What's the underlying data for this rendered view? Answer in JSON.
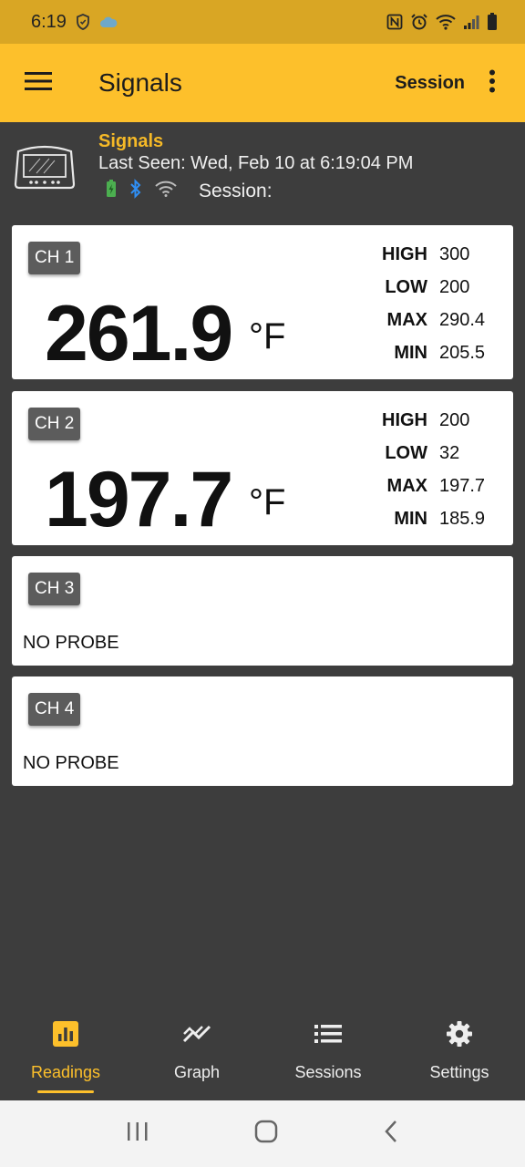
{
  "status_bar": {
    "time": "6:19",
    "icons": [
      "shield-icon",
      "cloud-icon",
      "nfc-icon",
      "alarm-icon",
      "wifi-icon",
      "signal-icon",
      "battery-icon"
    ]
  },
  "app_bar": {
    "title": "Signals",
    "session_label": "Session",
    "icons": [
      "menu-icon",
      "more-vert-icon"
    ]
  },
  "device": {
    "name": "Signals",
    "last_seen": "Last Seen: Wed, Feb 10 at 6:19:04 PM",
    "session_label": "Session:",
    "status_icons": [
      "battery-charging-icon",
      "bluetooth-icon",
      "wifi-icon"
    ],
    "colors": {
      "name": "#f5b927",
      "battery": "#4caf50",
      "bluetooth": "#2f8ff5"
    }
  },
  "channels": [
    {
      "label": "CH 1",
      "reading": "261.9",
      "unit": "°F",
      "stats": [
        {
          "label": "HIGH",
          "value": "300"
        },
        {
          "label": "LOW",
          "value": "200"
        },
        {
          "label": "MAX",
          "value": "290.4"
        },
        {
          "label": "MIN",
          "value": "205.5"
        }
      ]
    },
    {
      "label": "CH 2",
      "reading": "197.7",
      "unit": "°F",
      "stats": [
        {
          "label": "HIGH",
          "value": "200"
        },
        {
          "label": "LOW",
          "value": "32"
        },
        {
          "label": "MAX",
          "value": "197.7"
        },
        {
          "label": "MIN",
          "value": "185.9"
        }
      ]
    },
    {
      "label": "CH 3",
      "status": "NO PROBE"
    },
    {
      "label": "CH 4",
      "status": "NO PROBE"
    }
  ],
  "bottom_nav": {
    "items": [
      {
        "label": "Readings",
        "icon": "bar-chart-icon",
        "active": true
      },
      {
        "label": "Graph",
        "icon": "trending-icon",
        "active": false
      },
      {
        "label": "Sessions",
        "icon": "list-icon",
        "active": false
      },
      {
        "label": "Settings",
        "icon": "gear-icon",
        "active": false
      }
    ],
    "colors": {
      "active": "#fdc02b",
      "inactive": "#eeeeee"
    }
  },
  "system_nav": {
    "icons": [
      "recents-icon",
      "home-icon",
      "back-icon"
    ]
  },
  "theme": {
    "accent": "#fdc02b",
    "status_bar": "#d9a624",
    "background": "#3d3d3d",
    "card": "#ffffff"
  }
}
